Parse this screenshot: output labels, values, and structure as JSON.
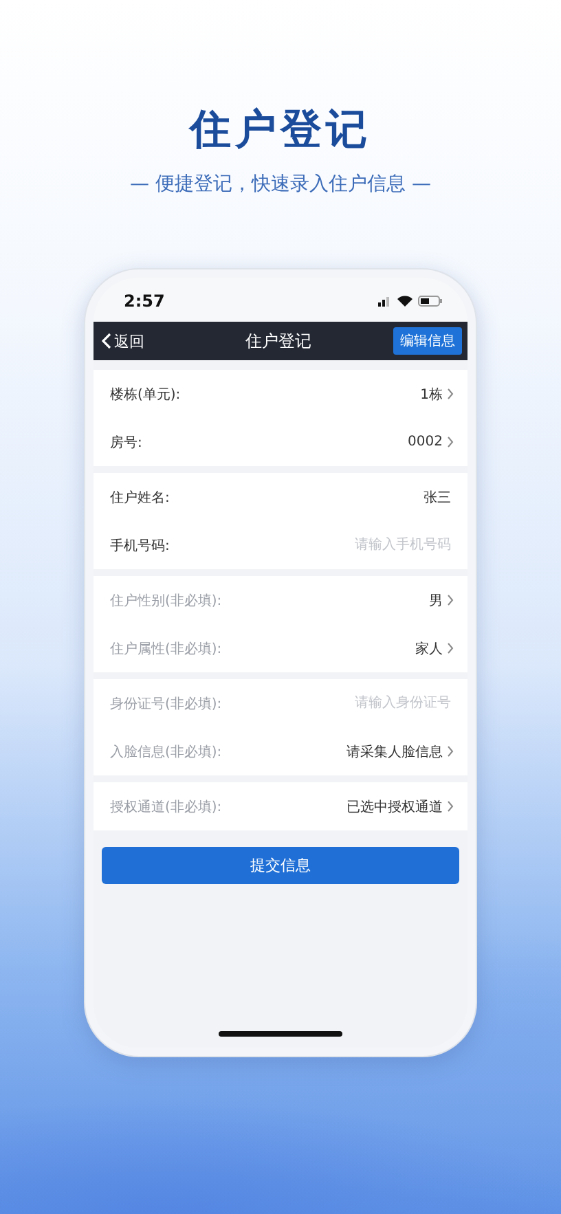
{
  "headline": {
    "title": "住户登记",
    "subtitle": "— 便捷登记，快速录入住户信息 —"
  },
  "phone": {
    "status_bar": {
      "time": "2:57"
    },
    "nav": {
      "back": "返回",
      "title": "住户登记",
      "action": "编辑信息"
    },
    "groups": [
      {
        "rows": [
          {
            "kind": "select",
            "label": "楼栋(单元):",
            "value": "1栋",
            "optional": false
          },
          {
            "kind": "select",
            "label": "房号:",
            "value": "0002",
            "optional": false
          }
        ]
      },
      {
        "rows": [
          {
            "kind": "input",
            "label": "住户姓名:",
            "value": "张三",
            "optional": false
          },
          {
            "kind": "input",
            "label": "手机号码:",
            "placeholder": "请输入手机号码",
            "optional": false
          }
        ]
      },
      {
        "rows": [
          {
            "kind": "select",
            "label": "住户性别(非必填):",
            "value": "男",
            "optional": true
          },
          {
            "kind": "select",
            "label": "住户属性(非必填):",
            "value": "家人",
            "optional": true
          }
        ]
      },
      {
        "rows": [
          {
            "kind": "input",
            "label": "身份证号(非必填):",
            "placeholder": "请输入身份证号",
            "optional": true
          },
          {
            "kind": "select",
            "label": "入脸信息(非必填):",
            "value": "请采集人脸信息",
            "optional": true
          }
        ]
      },
      {
        "rows": [
          {
            "kind": "select",
            "label": "授权通道(非必填):",
            "value": "已选中授权通道",
            "optional": true
          }
        ]
      }
    ],
    "submit": "提交信息"
  }
}
